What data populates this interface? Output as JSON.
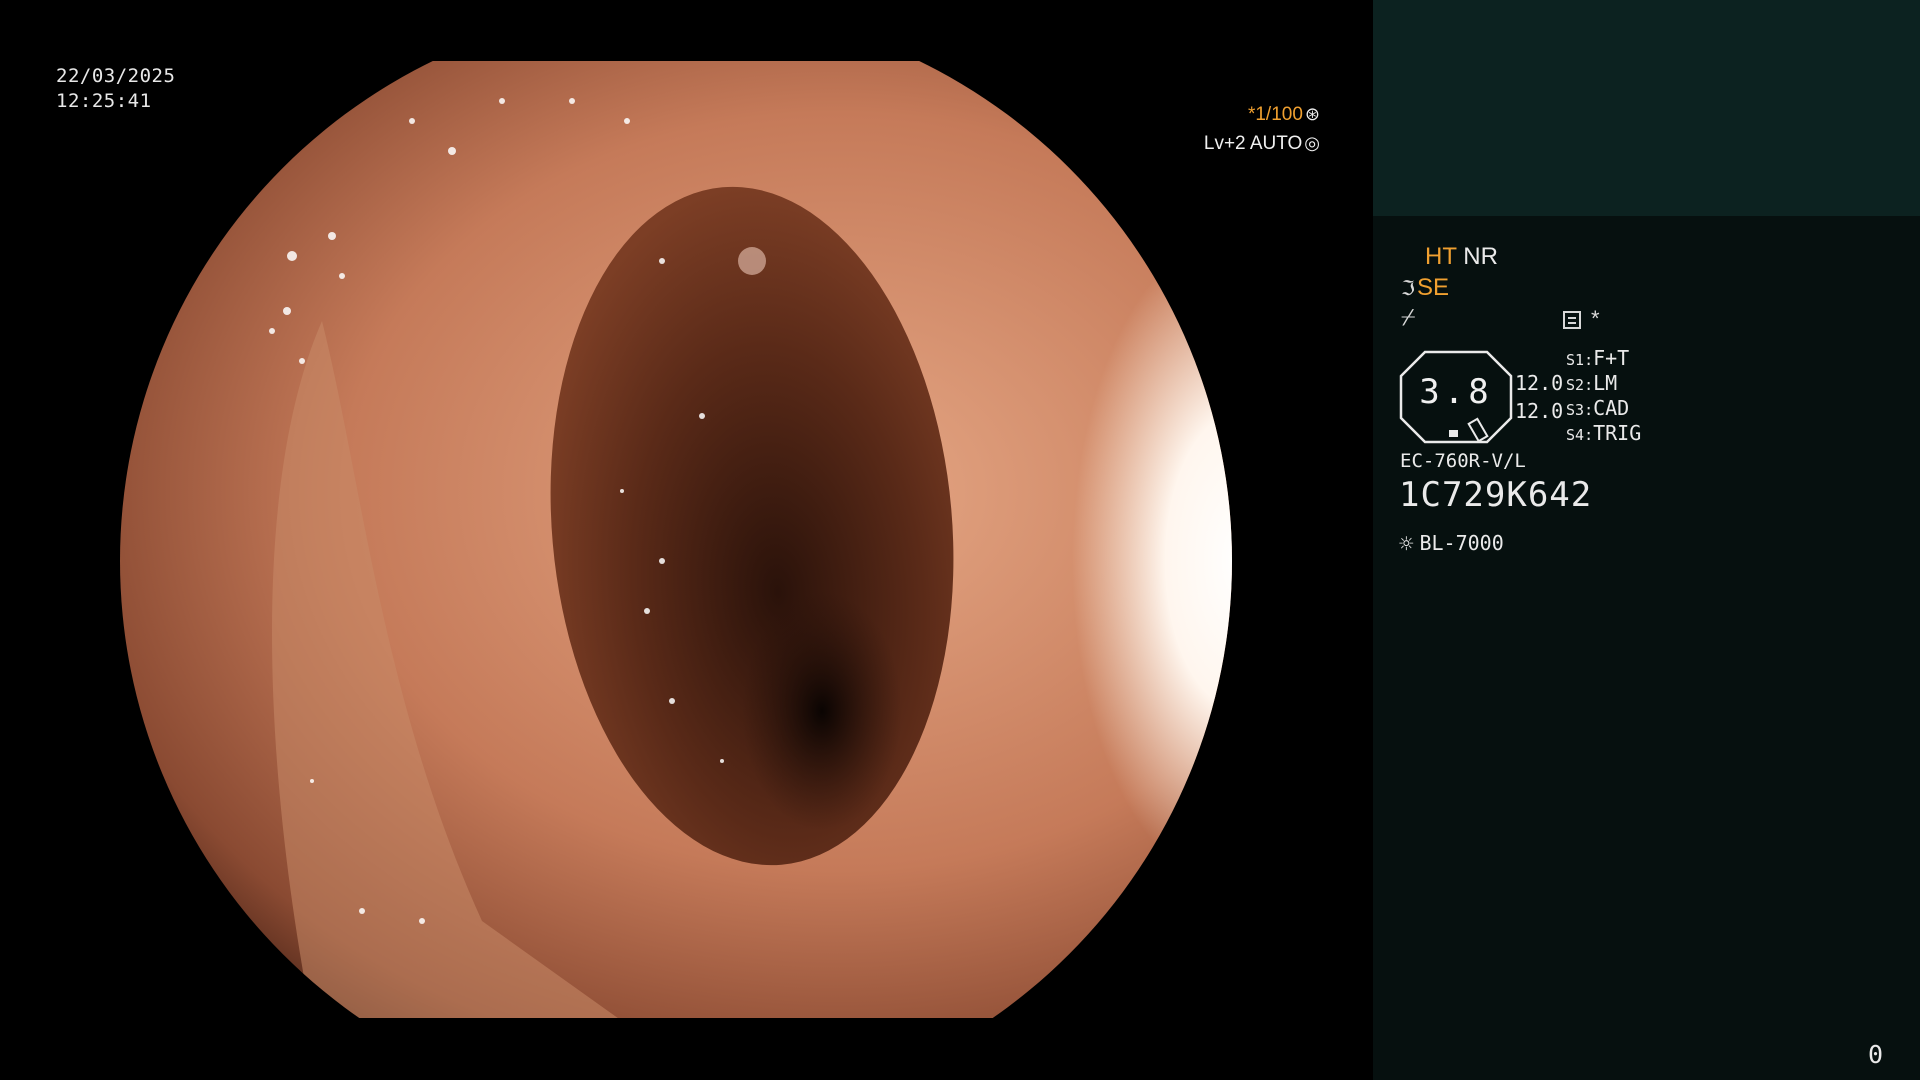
{
  "overlay": {
    "date": "22/03/2025",
    "time": "12:25:41",
    "shutter_symbol": "*",
    "shutter_value": "1/100",
    "shutter_icon": "aperture-icon",
    "level": "Lv+2 AUTO",
    "level_icon": "auto-iris-icon"
  },
  "panel": {
    "ht_label": "HT",
    "nr_label": "NR",
    "se_label": "SE",
    "se_icon": "enhance-curve-icon",
    "freeze_icon": "freeze-icon",
    "memo_icon": "memo-icon",
    "memo_symbol": "*",
    "scope_value": "3.8",
    "scope_values": [
      "12.0",
      "12.0"
    ],
    "switches": [
      {
        "key": "S1",
        "value": "F+T"
      },
      {
        "key": "S2",
        "value": "LM"
      },
      {
        "key": "S3",
        "value": "CAD"
      },
      {
        "key": "S4",
        "value": "TRIG"
      }
    ],
    "scope_model": "EC-760R-V/L",
    "scope_serial": "1C729K642",
    "light_source": "BL-7000",
    "light_icon": "light-source-icon",
    "image_counter": "0"
  },
  "colors": {
    "accent_orange": "#f0a030",
    "panel_top": "#0c2220",
    "panel_bg": "#06100f"
  }
}
